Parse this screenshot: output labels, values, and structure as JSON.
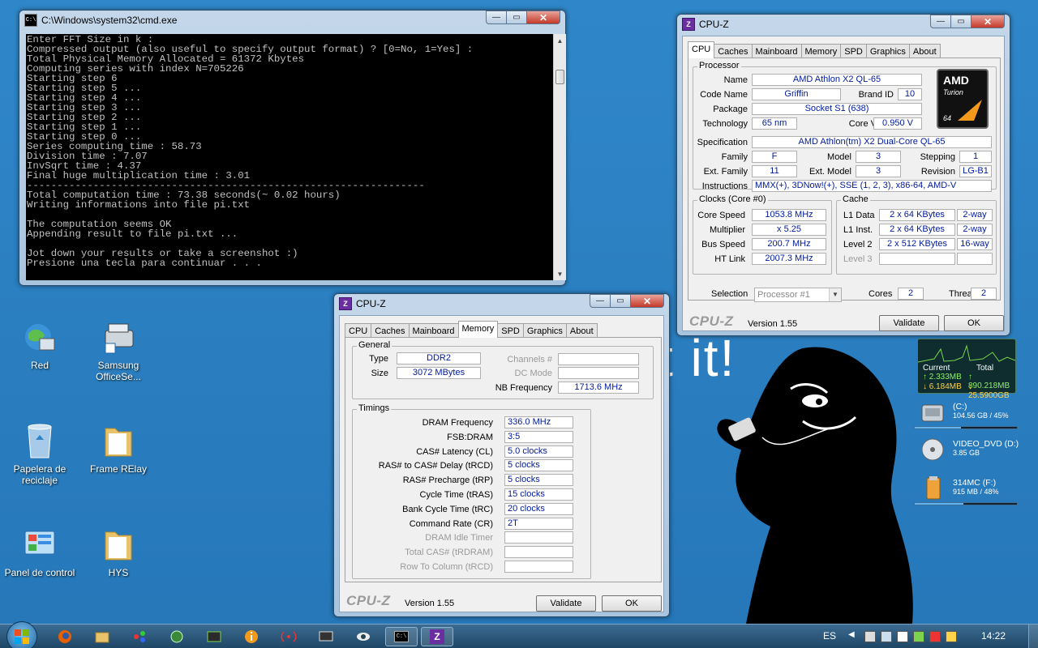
{
  "desktop": {
    "wallpaper_text": "t it!",
    "icons": [
      {
        "label": "Red",
        "glyph": "network-icon"
      },
      {
        "label": "Samsung OfficeSe...",
        "glyph": "scanner-icon"
      },
      {
        "label": "Papelera de reciclaje",
        "glyph": "recycle-bin-icon"
      },
      {
        "label": "Frame RElay",
        "glyph": "folder-icon"
      },
      {
        "label": "Panel de control",
        "glyph": "control-panel-icon"
      },
      {
        "label": "HYS",
        "glyph": "folder-icon"
      }
    ]
  },
  "cmd": {
    "title": "C:\\Windows\\system32\\cmd.exe",
    "icon": "cmd-icon",
    "lines": [
      "Enter FFT Size in k :",
      "Compressed output (also useful to specify output format) ? [0=No, 1=Yes] :",
      "Total Physical Memory Allocated = 61372 Kbytes",
      "Computing series with index N=705226",
      "Starting step 6",
      "Starting step 5 ...",
      "Starting step 4 ...",
      "Starting step 3 ...",
      "Starting step 2 ...",
      "Starting step 1 ...",
      "Starting step 0 ...",
      "Series computing time : 58.73",
      "Division time : 7.07",
      "InvSqrt time : 4.37",
      "Final huge multiplication time : 3.01",
      "------------------------------------------------------------------",
      "Total computation time : 73.38 seconds(~ 0.02 hours)",
      "Writing informations into file pi.txt",
      "",
      "The computation seems OK",
      "Appending result to file pi.txt ...",
      "",
      "Jot down your results or take a screenshot :)",
      "Presione una tecla para continuar . . ."
    ]
  },
  "cpuz_cpu": {
    "title": "CPU-Z",
    "tabs": [
      "CPU",
      "Caches",
      "Mainboard",
      "Memory",
      "SPD",
      "Graphics",
      "About"
    ],
    "active_tab": "CPU",
    "processor_group": "Processor",
    "name_label": "Name",
    "name": "AMD Athlon X2 QL-65",
    "codename_label": "Code Name",
    "codename": "Griffin",
    "brandid_label": "Brand ID",
    "brandid": "10",
    "package_label": "Package",
    "package": "Socket S1 (638)",
    "technology_label": "Technology",
    "technology": "65 nm",
    "corevid_label": "Core VID",
    "corevid": "0.950 V",
    "spec_label": "Specification",
    "spec": "AMD Athlon(tm) X2 Dual-Core QL-65",
    "family_label": "Family",
    "family": "F",
    "model_label": "Model",
    "model": "3",
    "stepping_label": "Stepping",
    "stepping": "1",
    "extfamily_label": "Ext. Family",
    "extfamily": "11",
    "extmodel_label": "Ext. Model",
    "extmodel": "3",
    "revision_label": "Revision",
    "revision": "LG-B1",
    "instructions_label": "Instructions",
    "instructions": "MMX(+), 3DNow!(+), SSE (1, 2, 3), x86-64, AMD-V",
    "clocks_group": "Clocks (Core #0)",
    "corespeed_label": "Core Speed",
    "corespeed": "1053.8 MHz",
    "multiplier_label": "Multiplier",
    "multiplier": "x 5.25",
    "busspeed_label": "Bus Speed",
    "busspeed": "200.7 MHz",
    "htlink_label": "HT Link",
    "htlink": "2007.3 MHz",
    "cache_group": "Cache",
    "l1data_label": "L1 Data",
    "l1data": "2 x 64 KBytes",
    "l1data_way": "2-way",
    "l1inst_label": "L1 Inst.",
    "l1inst": "2 x 64 KBytes",
    "l1inst_way": "2-way",
    "l2_label": "Level 2",
    "l2": "2 x 512 KBytes",
    "l2_way": "16-way",
    "l3_label": "Level 3",
    "selection_label": "Selection",
    "selection": "Processor #1",
    "cores_label": "Cores",
    "cores": "2",
    "threads_label": "Threads",
    "threads": "2",
    "logo": "CPU-Z",
    "version": "Version 1.55",
    "validate": "Validate",
    "ok": "OK",
    "amd_logo_text": "AMD",
    "amd_logo_sub": "Turion",
    "amd_logo_64": "64"
  },
  "cpuz_mem": {
    "title": "CPU-Z",
    "tabs": [
      "CPU",
      "Caches",
      "Mainboard",
      "Memory",
      "SPD",
      "Graphics",
      "About"
    ],
    "active_tab": "Memory",
    "general_group": "General",
    "type_label": "Type",
    "type": "DDR2",
    "size_label": "Size",
    "size": "3072 MBytes",
    "channels_label": "Channels #",
    "dcmode_label": "DC Mode",
    "nbfreq_label": "NB Frequency",
    "nbfreq": "1713.6 MHz",
    "timings_group": "Timings",
    "timings": [
      {
        "label": "DRAM Frequency",
        "value": "336.0 MHz",
        "dim": false
      },
      {
        "label": "FSB:DRAM",
        "value": "3:5",
        "dim": false
      },
      {
        "label": "CAS# Latency (CL)",
        "value": "5.0 clocks",
        "dim": false
      },
      {
        "label": "RAS# to CAS# Delay (tRCD)",
        "value": "5 clocks",
        "dim": false
      },
      {
        "label": "RAS# Precharge (tRP)",
        "value": "5 clocks",
        "dim": false
      },
      {
        "label": "Cycle Time (tRAS)",
        "value": "15 clocks",
        "dim": false
      },
      {
        "label": "Bank Cycle Time (tRC)",
        "value": "20 clocks",
        "dim": false
      },
      {
        "label": "Command Rate (CR)",
        "value": "2T",
        "dim": false
      },
      {
        "label": "DRAM Idle Timer",
        "value": "",
        "dim": true
      },
      {
        "label": "Total CAS# (tRDRAM)",
        "value": "",
        "dim": true
      },
      {
        "label": "Row To Column (tRCD)",
        "value": "",
        "dim": true
      }
    ],
    "logo": "CPU-Z",
    "version": "Version 1.55",
    "validate": "Validate",
    "ok": "OK"
  },
  "gadgets": {
    "net_current_label": "Current",
    "net_total_label": "Total",
    "net_current_up": "2.333MB",
    "net_current_down": "6.184MB",
    "net_total_up": "890.218MB",
    "net_total_down": "25.5900GB",
    "drives": [
      {
        "name": "(C:)",
        "size": "104.56 GB / 45%",
        "icon": "hard-drive-icon",
        "fill": 0.45
      },
      {
        "name": "VIDEO_DVD (D:)",
        "size": "3.85 GB",
        "icon": "dvd-icon",
        "fill": 0
      },
      {
        "name": "314MC (F:)",
        "size": "915 MB / 48%",
        "icon": "usb-drive-icon",
        "fill": 0.48
      }
    ]
  },
  "taskbar": {
    "start": "start-orb",
    "language": "ES",
    "clock": "14:22",
    "pinned": [
      "firefox-icon",
      "explorer-icon",
      "network-app-icon",
      "gpu-tool-icon",
      "gpu-z-icon",
      "info-icon",
      "antenna-icon",
      "tv-icon",
      "eye-icon",
      "cmd-icon",
      "cpuz-icon"
    ]
  },
  "colors": {
    "wallpaper": "#2a7ec0",
    "value_text": "#001a9c",
    "console_bg": "#000000",
    "console_fg": "#c0c0c0"
  }
}
